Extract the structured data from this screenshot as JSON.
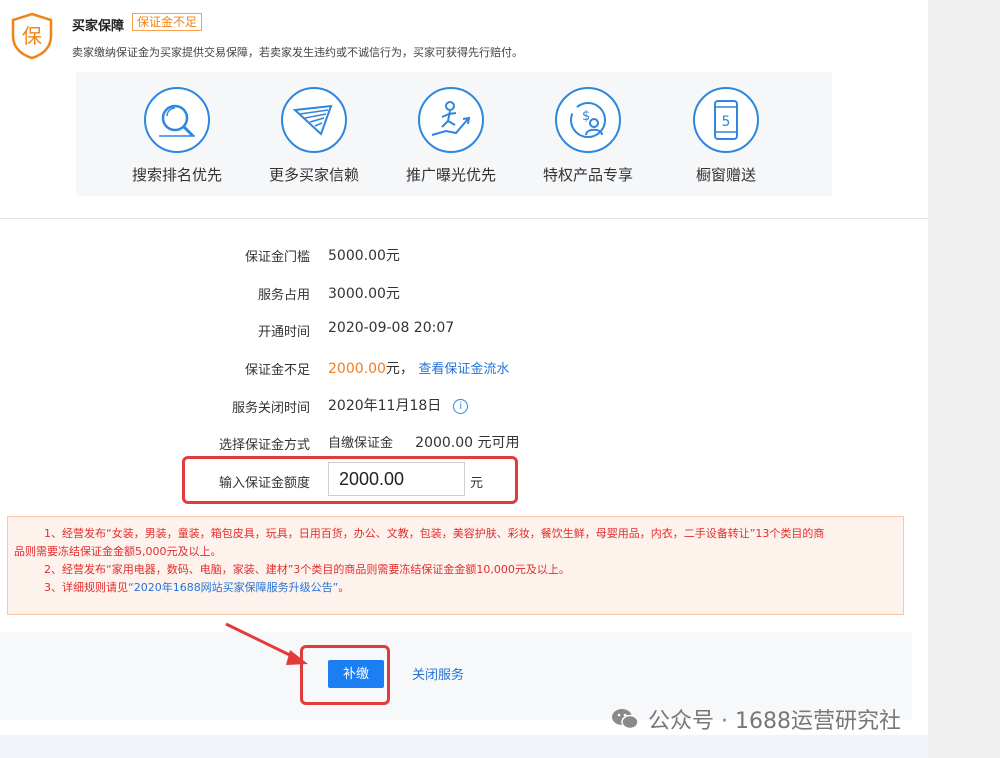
{
  "header": {
    "icon_char": "保",
    "title": "买家保障",
    "badge": "保证金不足",
    "description": "卖家缴纳保证金为买家提供交易保障，若卖家发生违约或不诚信行为，买家可获得先行赔付。"
  },
  "benefits": [
    {
      "label": "搜索排名优先",
      "icon": "search-magnifier-icon"
    },
    {
      "label": "更多买家信赖",
      "icon": "trust-wings-icon"
    },
    {
      "label": "推广曝光优先",
      "icon": "running-growth-icon"
    },
    {
      "label": "特权产品专享",
      "icon": "exclusive-product-icon"
    },
    {
      "label": "橱窗赠送",
      "icon": "phone-showcase-icon",
      "icon_text": "5"
    }
  ],
  "form": {
    "threshold": {
      "label": "保证金门槛",
      "value": "5000.00元"
    },
    "service_used": {
      "label": "服务占用",
      "value": "3000.00元"
    },
    "open_time": {
      "label": "开通时间",
      "value": "2020-09-08 20:07"
    },
    "insufficient": {
      "label": "保证金不足",
      "amount": "2000.00",
      "unit": "元，",
      "link": "查看保证金流水"
    },
    "close_time": {
      "label": "服务关闭时间",
      "value": "2020年11月18日",
      "info_icon": "i"
    },
    "method": {
      "label": "选择保证金方式",
      "option": "自缴保证金",
      "available": "2000.00 元可用"
    },
    "amount_input": {
      "label": "输入保证金额度",
      "value": "2000.00",
      "unit": "元"
    }
  },
  "notice": {
    "line1": "1、经营发布“女装，男装，童装，箱包皮具，玩具，日用百货，办公、文教，包装，美容护肤、彩妆，餐饮生鲜，母婴用品，内衣，二手设备转让”13个类目的商",
    "line1b": "品则需要冻结保证金金额5,000元及以上。",
    "line2": "2、经营发布“家用电器，数码、电脑，家装、建材”3个类目的商品则需要冻结保证金金额10,000元及以上。",
    "line3_prefix": "3、详细规则请见",
    "line3_link": "“2020年1688网站买家保障服务升级公告”",
    "line3_suffix": "。"
  },
  "actions": {
    "pay_button": "补缴",
    "close_link": "关闭服务"
  },
  "watermark": {
    "text": "公众号 · 1688运营研究社"
  },
  "colors": {
    "accent_blue": "#1b7ef2",
    "badge_orange": "#f08419",
    "warning_red": "#e22d2d",
    "highlight_frame": "#e23b3b"
  }
}
